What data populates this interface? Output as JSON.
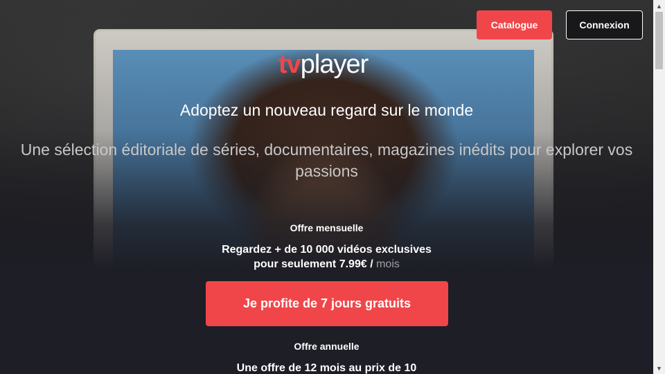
{
  "header": {
    "catalogue_label": "Catalogue",
    "connexion_label": "Connexion"
  },
  "brand": {
    "logo_tv": "tv",
    "logo_player": "player",
    "accent_color": "#f0464a"
  },
  "hero": {
    "tagline": "Adoptez un nouveau regard sur le monde",
    "subtitle": "Une sélection éditoriale de séries, documentaires, magazines inédits pour explorer vos passions"
  },
  "offers": {
    "monthly": {
      "title": "Offre mensuelle",
      "line1": "Regardez + de 10 000 vidéos exclusives",
      "line2_prefix": "pour seulement 7.99€ /",
      "line2_suffix": "mois",
      "cta_label": "Je profite de 7 jours gratuits"
    },
    "annual": {
      "title": "Offre annuelle",
      "line1": "Une offre de 12 mois au prix de 10"
    }
  },
  "icons": {
    "scroll_up": "scroll-up-arrow-icon",
    "scroll_down": "scroll-down-arrow-icon"
  }
}
